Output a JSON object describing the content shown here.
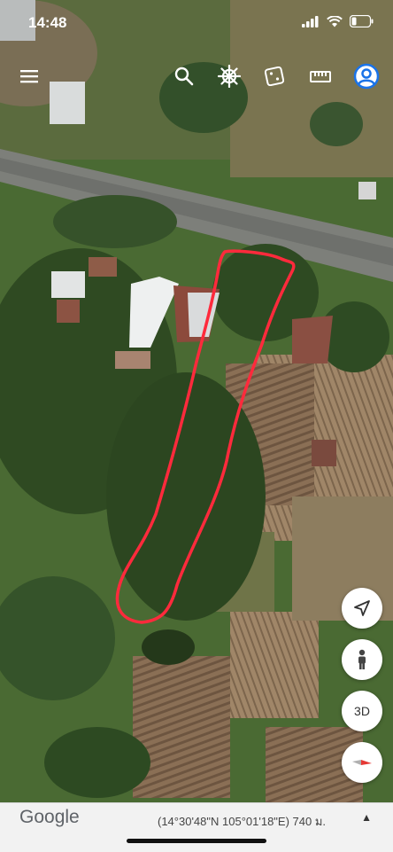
{
  "status": {
    "time": "14:48"
  },
  "toolbar": {
    "menu_icon": "menu-icon",
    "search_icon": "search-icon",
    "voyager_icon": "ship-wheel-icon",
    "feeling_lucky_icon": "dice-icon",
    "measure_icon": "ruler-icon",
    "account_icon": "account-icon",
    "accent_color": "#1a73e8"
  },
  "controls": {
    "location_icon": "navigation-arrow-icon",
    "pegman_icon": "pegman-icon",
    "view_3d_label": "3D",
    "compass_icon": "compass-icon",
    "compass_color": "#e53935"
  },
  "footer": {
    "logo": "Google",
    "coordinates": "(14°30'48\"N 105°01'18\"E) 740 ม.",
    "expand_icon": "▲"
  },
  "map": {
    "annotation_color": "#ff2a3c"
  }
}
